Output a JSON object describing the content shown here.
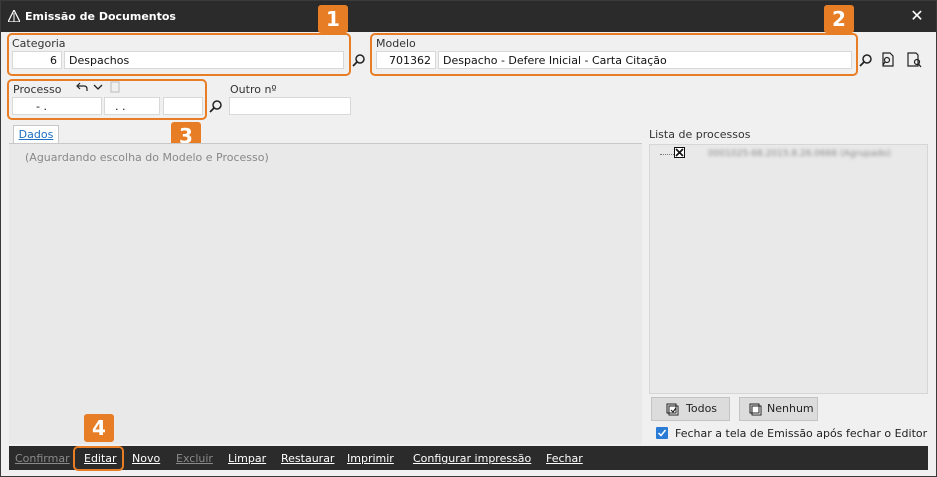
{
  "window": {
    "title": "Emissão de Documentos"
  },
  "categoria": {
    "label": "Categoria",
    "code": "6",
    "name": "Despachos"
  },
  "modelo": {
    "label": "Modelo",
    "code": "701362",
    "name": "Despacho - Defere Inicial - Carta Citação"
  },
  "processo": {
    "label": "Processo",
    "part1": "- .",
    "part2": ". .",
    "part3": ""
  },
  "outro": {
    "label": "Outro nº",
    "value": ""
  },
  "tabs": [
    {
      "label": "Dados"
    }
  ],
  "dados": {
    "placeholder": "(Aguardando escolha do Modelo e Processo)"
  },
  "lista": {
    "title": "Lista de processos",
    "items": [
      {
        "text": "0001025-68.2015.8.26.0666 (Agrupado)",
        "checked": true
      }
    ]
  },
  "buttons": {
    "todos": "Todos",
    "nenhum": "Nenhum"
  },
  "fechar_checkbox": {
    "label": "Fechar a tela de Emissão após fechar o Editor",
    "checked": true
  },
  "toolbar": {
    "confirmar": "Confirmar",
    "editar": "Editar",
    "novo": "Novo",
    "excluir": "Excluir",
    "limpar": "Limpar",
    "restaurar": "Restaurar",
    "imprimir": "Imprimir",
    "configurar": "Configurar impressão",
    "fechar": "Fechar"
  },
  "callouts": [
    "1",
    "2",
    "3",
    "4"
  ],
  "colors": {
    "accent": "#e77d25",
    "titlebar": "#2b2b2b",
    "link": "#1a6fc2",
    "checkbox": "#2a7bd6"
  },
  "icons": [
    "app-icon",
    "close-icon",
    "search-icon",
    "search-doc-icon",
    "search-list-icon",
    "undo-icon",
    "chevron-down-icon",
    "doc-icon",
    "checkbox-icon",
    "select-all-icon",
    "select-none-icon"
  ]
}
